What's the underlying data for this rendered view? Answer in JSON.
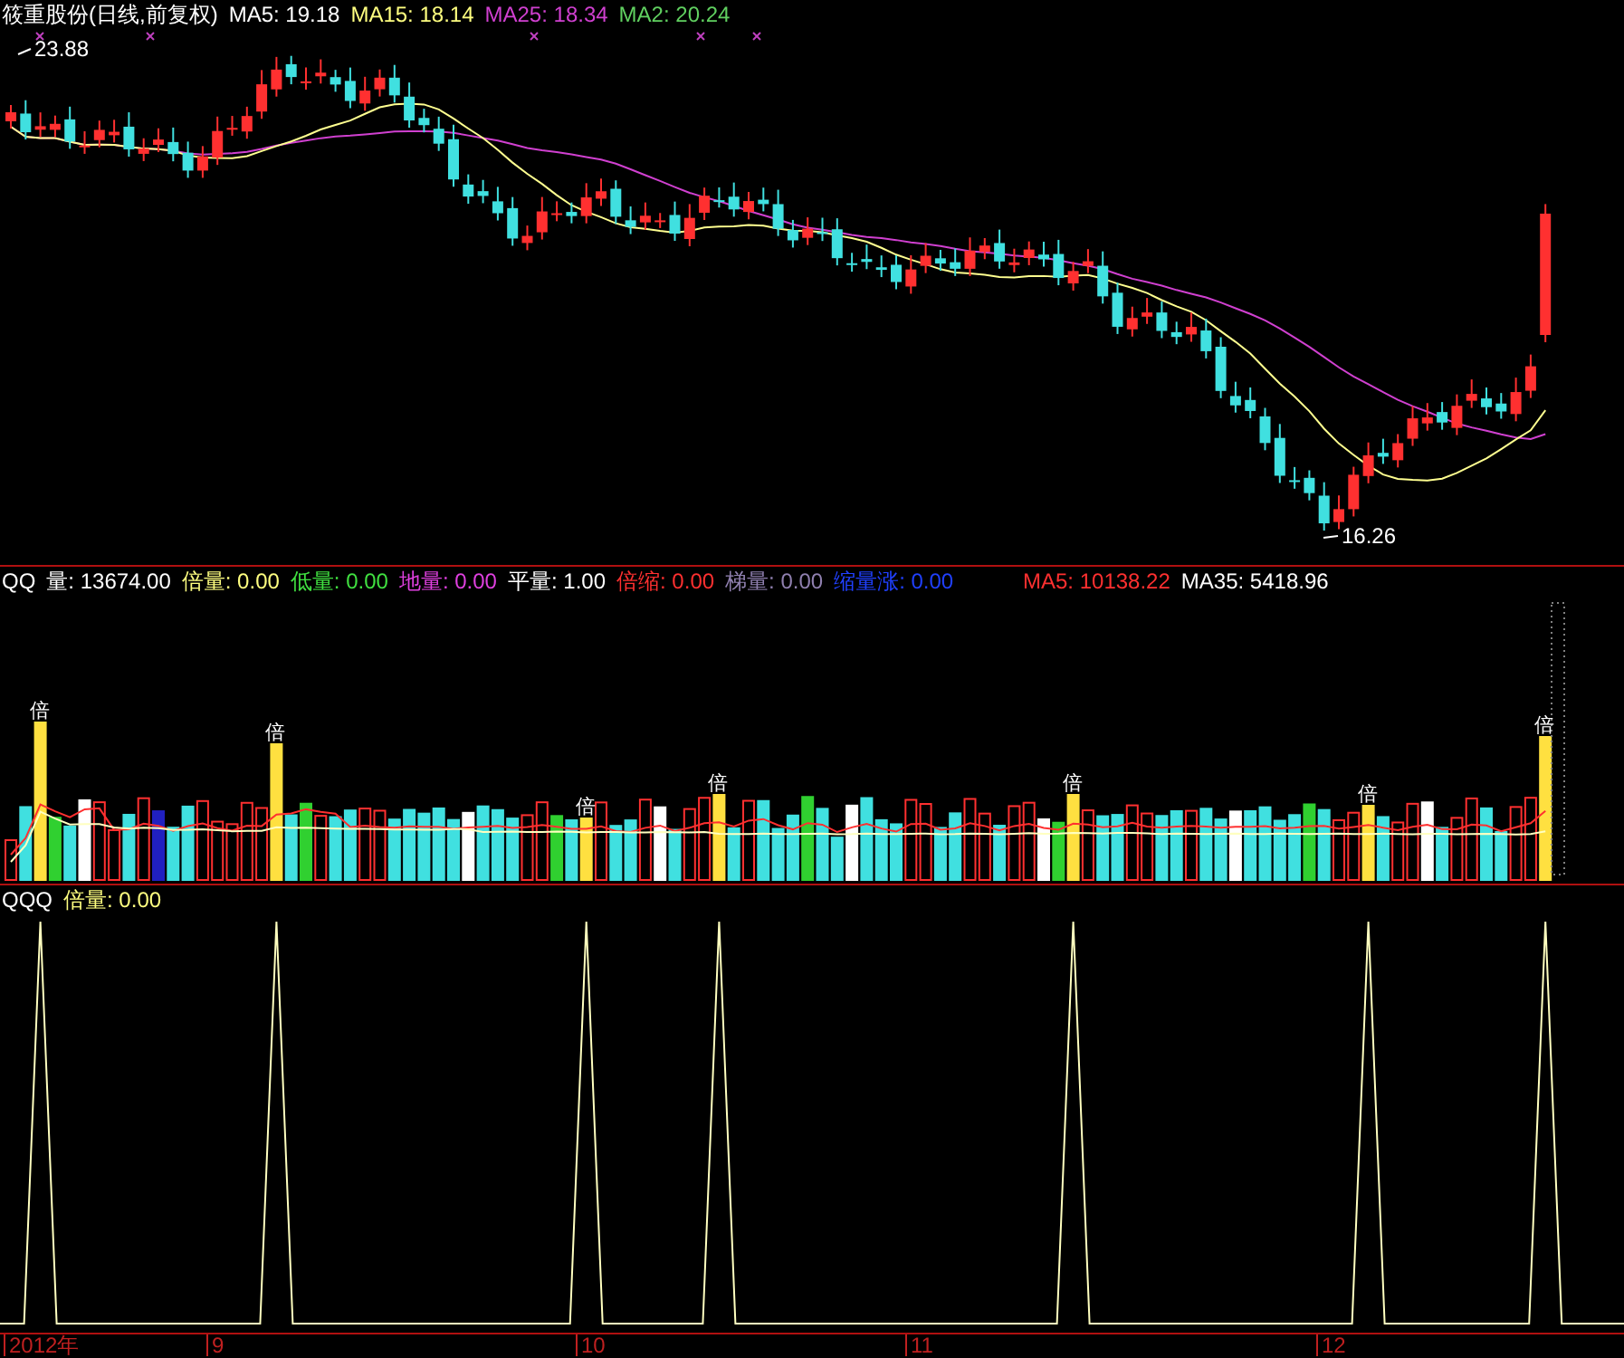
{
  "price_panel": {
    "title": "筱重股份(日线,前复权)",
    "indicators": [
      {
        "label": "MA5: 19.18",
        "color": "#ffffff"
      },
      {
        "label": "MA15: 18.14",
        "color": "#ffff80"
      },
      {
        "label": "MA25: 18.34",
        "color": "#d040d0"
      },
      {
        "label": "MA2: 20.24",
        "color": "#60d060"
      }
    ],
    "high_label": "23.88",
    "low_label": "16.26"
  },
  "volume_panel": {
    "indicators": [
      {
        "label": "QQ",
        "color": "#ffffff"
      },
      {
        "label": "量: 13674.00",
        "color": "#ffffff"
      },
      {
        "label": "倍量: 0.00",
        "color": "#ffff80"
      },
      {
        "label": "低量: 0.00",
        "color": "#40e040"
      },
      {
        "label": "地量: 0.00",
        "color": "#e040e0"
      },
      {
        "label": "平量: 1.00",
        "color": "#ffffff"
      },
      {
        "label": "倍缩: 0.00",
        "color": "#ff3030"
      },
      {
        "label": "梯量: 0.00",
        "color": "#9080b0"
      },
      {
        "label": "缩量涨: 0.00",
        "color": "#2040ff"
      }
    ],
    "averages": [
      {
        "label": "MA5: 10138.22",
        "color": "#ff3030"
      },
      {
        "label": "MA35: 5418.96",
        "color": "#ffffff"
      }
    ],
    "markers": [
      "倍",
      "倍",
      "倍",
      "倍",
      "倍",
      "倍",
      "倍"
    ]
  },
  "signal_panel": {
    "indicators": [
      {
        "label": "QQQ",
        "color": "#ffffff"
      },
      {
        "label": "倍量: 0.00",
        "color": "#ffff80"
      }
    ]
  },
  "time_axis": [
    "2012年",
    "9",
    "10",
    "11",
    "12"
  ]
}
